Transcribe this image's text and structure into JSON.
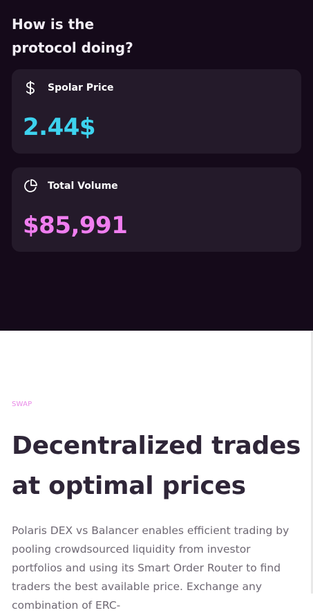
{
  "stats_section": {
    "heading": "How is the protocol doing?",
    "cards": [
      {
        "icon": "dollar-icon",
        "label": "Spolar Price",
        "value": "2.44$",
        "value_color": "#3dd2ee"
      },
      {
        "icon": "pie-chart-icon",
        "label": "Total Volume",
        "value": "$85,991",
        "value_color": "#f07ef0"
      }
    ]
  },
  "swap_section": {
    "eyebrow": "SWAP",
    "title": "Decentralized trades at optimal prices",
    "body": "Polaris DEX vs Balancer enables efficient trading by pooling crowdsourced liquidity from investor portfolios and using its Smart Order Router to find traders the best available price. Exchange any combination of ERC-"
  },
  "colors": {
    "dark_bg": "#150a1a",
    "card_bg": "#241a2a",
    "accent_cyan": "#3dd2ee",
    "accent_pink": "#f07ef0",
    "title_text": "#2f2638"
  }
}
